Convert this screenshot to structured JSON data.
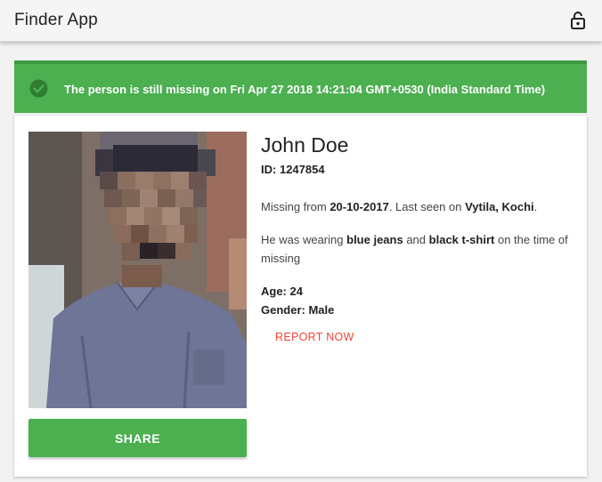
{
  "app": {
    "title": "Finder App",
    "lock_icon": "lock-open-icon"
  },
  "alert": {
    "icon": "check-circle-icon",
    "text": "The person is still missing on Fri Apr 27 2018 14:21:04 GMT+0530 (India Standard Time)"
  },
  "person": {
    "name": "John Doe",
    "id_label": "ID:",
    "id": "1247854",
    "missing_prefix": "Missing from",
    "missing_date": "20-10-2017",
    "last_seen_prefix": ". Last seen on",
    "last_seen_place": "Vytila, Kochi",
    "last_seen_suffix": ".",
    "wearing_prefix": "He was wearing",
    "item1": "blue jeans",
    "and": "and",
    "item2": "black t-shirt",
    "wearing_suffix": "on the time of missing",
    "age_label": "Age:",
    "age": "24",
    "gender_label": "Gender:",
    "gender": "Male"
  },
  "actions": {
    "report_label": "REPORT NOW",
    "share_label": "SHARE"
  },
  "colors": {
    "success": "#4caf50",
    "report": "#f44336"
  }
}
